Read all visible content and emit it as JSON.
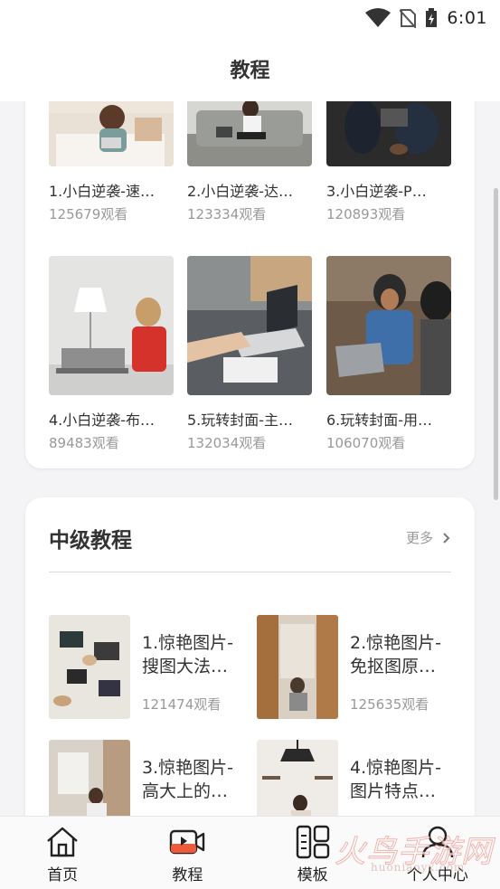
{
  "status_bar": {
    "time": "6:01"
  },
  "header": {
    "title": "教程"
  },
  "beginner_tutorials": [
    {
      "name": "1.小白逆袭-速…",
      "views": "125679观看"
    },
    {
      "name": "2.小白逆袭-达…",
      "views": "123334观看"
    },
    {
      "name": "3.小白逆袭-P…",
      "views": "120893观看"
    },
    {
      "name": "4.小白逆袭-布…",
      "views": "89483观看"
    },
    {
      "name": "5.玩转封面-主…",
      "views": "132034观看"
    },
    {
      "name": "6.玩转封面-用…",
      "views": "106070观看"
    }
  ],
  "intermediate": {
    "title": "中级教程",
    "more_label": "更多",
    "items": [
      {
        "name": "1.惊艳图片-搜图大法…",
        "views": "121474观看"
      },
      {
        "name": "2.惊艳图片-免抠图原…",
        "views": "125635观看"
      },
      {
        "name": "3.惊艳图片-高大上的…",
        "views": ""
      },
      {
        "name": "4.惊艳图片-图片特点…",
        "views": ""
      }
    ]
  },
  "tabbar": {
    "tabs": [
      {
        "label": "首页",
        "icon": "home-icon"
      },
      {
        "label": "教程",
        "icon": "video-play-icon",
        "accent": "#f05a3a"
      },
      {
        "label": "模板",
        "icon": "template-grid-icon"
      },
      {
        "label": "个人中心",
        "icon": "user-icon"
      }
    ]
  },
  "watermark": {
    "text": "火鸟手游网",
    "sub": "huoniaoyx.com"
  }
}
